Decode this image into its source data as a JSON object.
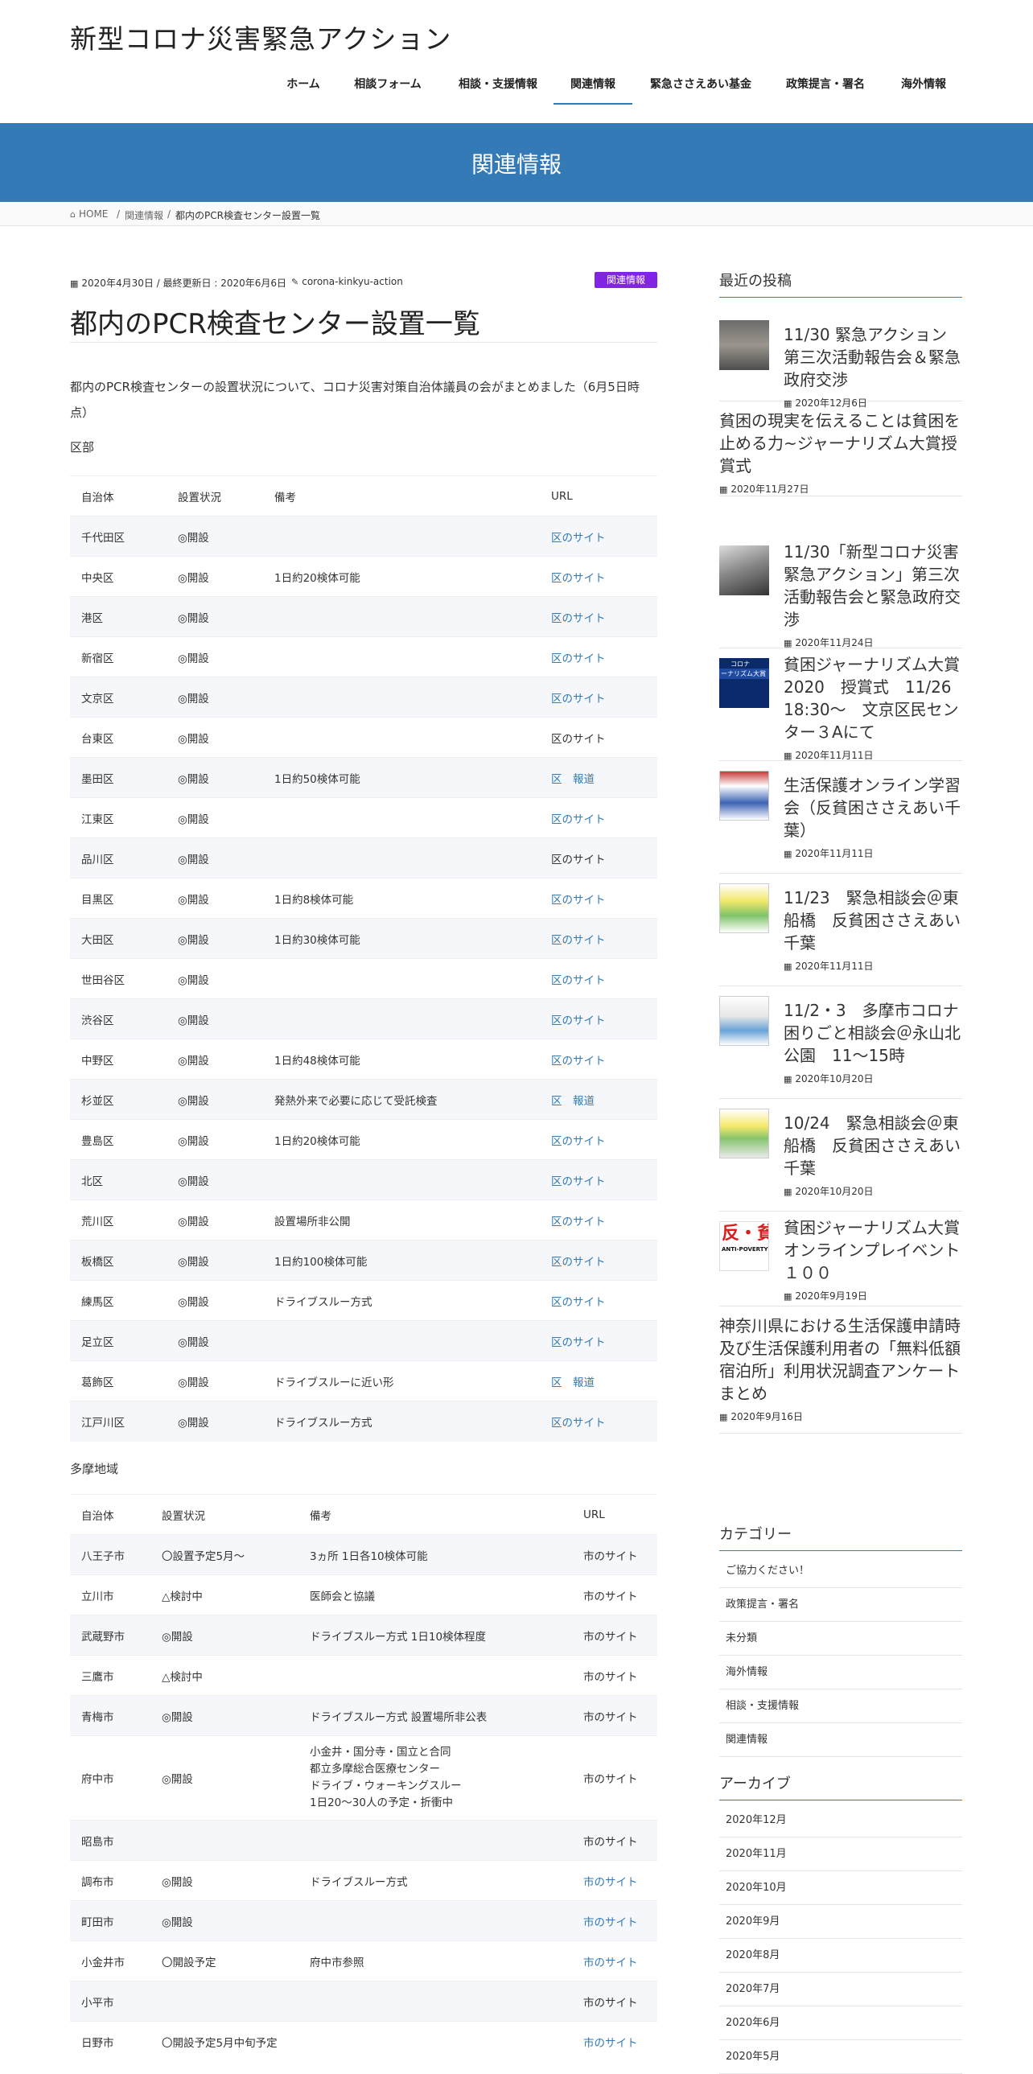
{
  "site_title": "新型コロナ災害緊急アクション",
  "nav": [
    "ホーム",
    "相談フォーム",
    "相談・支援情報",
    "関連情報",
    "緊急ささえあい基金",
    "政策提言・署名",
    "海外情報"
  ],
  "banner_title": "関連情報",
  "breadcrumb": {
    "home": "HOME",
    "sep": "/",
    "parent": "関連情報",
    "current": "都内のPCR検査センター設置一覧"
  },
  "post": {
    "meta": "2020年4月30日 / 最終更新日 : 2020年6月6日",
    "author": "corona-kinkyu-action",
    "category": "関連情報",
    "title": "都内のPCR検査センター設置一覧",
    "intro": "都内のPCR検査センターの設置状況について、コロナ災害対策自治体議員の会がまとめました（6月5日時点）"
  },
  "ku": {
    "label": "区部",
    "headers": [
      "自治体",
      "設置状況",
      "備考",
      "URL"
    ],
    "rows": [
      [
        "千代田区",
        "◎開設",
        "",
        "区のサイト"
      ],
      [
        "中央区",
        "◎開設",
        "1日約20検体可能",
        "区のサイト"
      ],
      [
        "港区",
        "◎開設",
        "",
        "区のサイト"
      ],
      [
        "新宿区",
        "◎開設",
        "",
        "区のサイト"
      ],
      [
        "文京区",
        "◎開設",
        "",
        "区のサイト"
      ],
      [
        "台東区",
        "◎開設",
        "",
        "区のサイト"
      ],
      [
        "墨田区",
        "◎開設",
        "1日約50検体可能",
        "区　報道"
      ],
      [
        "江東区",
        "◎開設",
        "",
        "区のサイト"
      ],
      [
        "品川区",
        "◎開設",
        "",
        "区のサイト"
      ],
      [
        "目黒区",
        "◎開設",
        "1日約8検体可能",
        "区のサイト"
      ],
      [
        "大田区",
        "◎開設",
        "1日約30検体可能",
        "区のサイト"
      ],
      [
        "世田谷区",
        "◎開設",
        "",
        "区のサイト"
      ],
      [
        "渋谷区",
        "◎開設",
        "",
        "区のサイト"
      ],
      [
        "中野区",
        "◎開設",
        "1日約48検体可能",
        "区のサイト"
      ],
      [
        "杉並区",
        "◎開設",
        "発熱外来で必要に応じて受託検査",
        "区　報道"
      ],
      [
        "豊島区",
        "◎開設",
        "1日約20検体可能",
        "区のサイト"
      ],
      [
        "北区",
        "◎開設",
        "",
        "区のサイト"
      ],
      [
        "荒川区",
        "◎開設",
        "設置場所非公開",
        "区のサイト"
      ],
      [
        "板橋区",
        "◎開設",
        "1日約100検体可能",
        "区のサイト"
      ],
      [
        "練馬区",
        "◎開設",
        "ドライブスルー方式",
        "区のサイト"
      ],
      [
        "足立区",
        "◎開設",
        "",
        "区のサイト"
      ],
      [
        "葛飾区",
        "◎開設",
        "ドライブスルーに近い形",
        "区　報道"
      ],
      [
        "江戸川区",
        "◎開設",
        "ドライブスルー方式",
        "区のサイト"
      ]
    ]
  },
  "tama": {
    "label": "多摩地域",
    "headers": [
      "自治体",
      "設置状況",
      "備考",
      "URL"
    ],
    "rows": [
      [
        "八王子市",
        "〇設置予定5月～",
        "3ヵ所 1日各10検体可能",
        "市のサイト"
      ],
      [
        "立川市",
        "△検討中",
        "医師会と協議",
        "市のサイト"
      ],
      [
        "武蔵野市",
        "◎開設",
        "ドライブスルー方式 1日10検体程度",
        "市のサイト"
      ],
      [
        "三鷹市",
        "△検討中",
        "",
        "市のサイト"
      ],
      [
        "青梅市",
        "◎開設",
        "ドライブスルー方式 設置場所非公表",
        "市のサイト"
      ],
      [
        "府中市",
        "◎開設",
        "小金井・国分寺・国立と合同\n都立多摩総合医療センター\nドライブ・ウォーキングスルー\n1日20～30人の予定・折衝中",
        "市のサイト"
      ],
      [
        "昭島市",
        "",
        "",
        "市のサイト"
      ],
      [
        "調布市",
        "◎開設",
        "ドライブスルー方式",
        "市のサイト"
      ],
      [
        "町田市",
        "◎開設",
        "",
        "市のサイト"
      ],
      [
        "小金井市",
        "〇開設予定",
        "府中市参照",
        "市のサイト"
      ],
      [
        "小平市",
        "",
        "",
        "市のサイト"
      ],
      [
        "日野市",
        "〇開設予定5月中旬予定",
        "",
        "市のサイト"
      ]
    ]
  },
  "sidebar": {
    "recent_heading": "最近の投稿",
    "posts": [
      {
        "title": "11/30 緊急アクション第三次活動報告会＆緊急政府交渉",
        "date": "2020年12月6日"
      },
      {
        "title": "貧困の現実を伝えることは貧困を止める力~ジャーナリズム大賞授賞式",
        "date": "2020年11月27日"
      },
      {
        "title": "11/30「新型コロナ災害緊急アクション」第三次活動報告会と緊急政府交渉",
        "date": "2020年11月24日"
      },
      {
        "title": "貧困ジャーナリズム大賞2020　授賞式　11/26 18:30～　文京区民センター３Aにて",
        "date": "2020年11月11日"
      },
      {
        "title": "生活保護オンライン学習会（反貧困ささえあい千葉）",
        "date": "2020年11月11日"
      },
      {
        "title": "11/23　緊急相談会＠東船橋　反貧困ささえあい千葉",
        "date": "2020年11月11日"
      },
      {
        "title": "11/2・3　多摩市コロナ困りごと相談会＠永山北公園　11～15時",
        "date": "2020年10月20日"
      },
      {
        "title": "10/24　緊急相談会＠東船橋　反貧困ささえあい千葉",
        "date": "2020年10月20日"
      },
      {
        "title": "貧困ジャーナリズム大賞オンラインプレイベント１００",
        "date": "2020年9月19日"
      },
      {
        "title": "神奈川県における生活保護申請時及び生活保護利用者の「無料低額宿泊所」利用状況調査アンケートまとめ",
        "date": "2020年9月16日"
      }
    ],
    "thumb_texts": {
      "t4": "コロナ",
      "t4b": "ーナリズム大賞",
      "t9": "反・貧",
      "t9b": "ANTI-POVERTY"
    },
    "category_heading": "カテゴリー",
    "categories": [
      "ご協力ください！",
      "政策提言・署名",
      "未分類",
      "海外情報",
      "相談・支援情報",
      "関連情報"
    ],
    "archive_heading": "アーカイブ",
    "archives": [
      "2020年12月",
      "2020年11月",
      "2020年10月",
      "2020年9月",
      "2020年8月",
      "2020年7月",
      "2020年6月",
      "2020年5月"
    ]
  }
}
